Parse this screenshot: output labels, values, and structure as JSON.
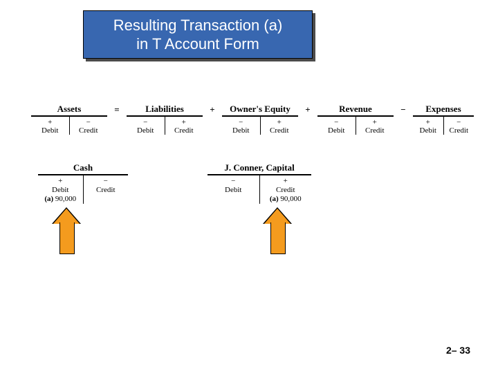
{
  "title": {
    "line1": "Resulting Transaction (a)",
    "line2": "in T Account Form"
  },
  "equation": {
    "assets": {
      "head": "Assets",
      "pm_left": "+",
      "pm_right": "−",
      "left": "Debit",
      "right": "Credit"
    },
    "sign1": "=",
    "liab": {
      "head": "Liabilities",
      "pm_left": "−",
      "pm_right": "+",
      "left": "Debit",
      "right": "Credit"
    },
    "sign2": "+",
    "oe": {
      "head": "Owner's Equity",
      "pm_left": "−",
      "pm_right": "+",
      "left": "Debit",
      "right": "Credit"
    },
    "sign3": "+",
    "rev": {
      "head": "Revenue",
      "pm_left": "−",
      "pm_right": "+",
      "left": "Debit",
      "right": "Credit"
    },
    "sign4": "−",
    "exp": {
      "head": "Expenses",
      "pm_left": "+",
      "pm_right": "−",
      "left": "Debit",
      "right": "Credit"
    }
  },
  "accounts": {
    "cash": {
      "head": "Cash",
      "pm_left": "+",
      "pm_right": "−",
      "left": "Debit",
      "right": "Credit",
      "entry_side": "left",
      "entry_label": "(a)",
      "entry_value": "90,000"
    },
    "capital": {
      "head": "J. Conner, Capital",
      "pm_left": "−",
      "pm_right": "+",
      "left": "Debit",
      "right": "Credit",
      "entry_side": "right",
      "entry_label": "(a)",
      "entry_value": "90,000"
    }
  },
  "page": "2– 33"
}
